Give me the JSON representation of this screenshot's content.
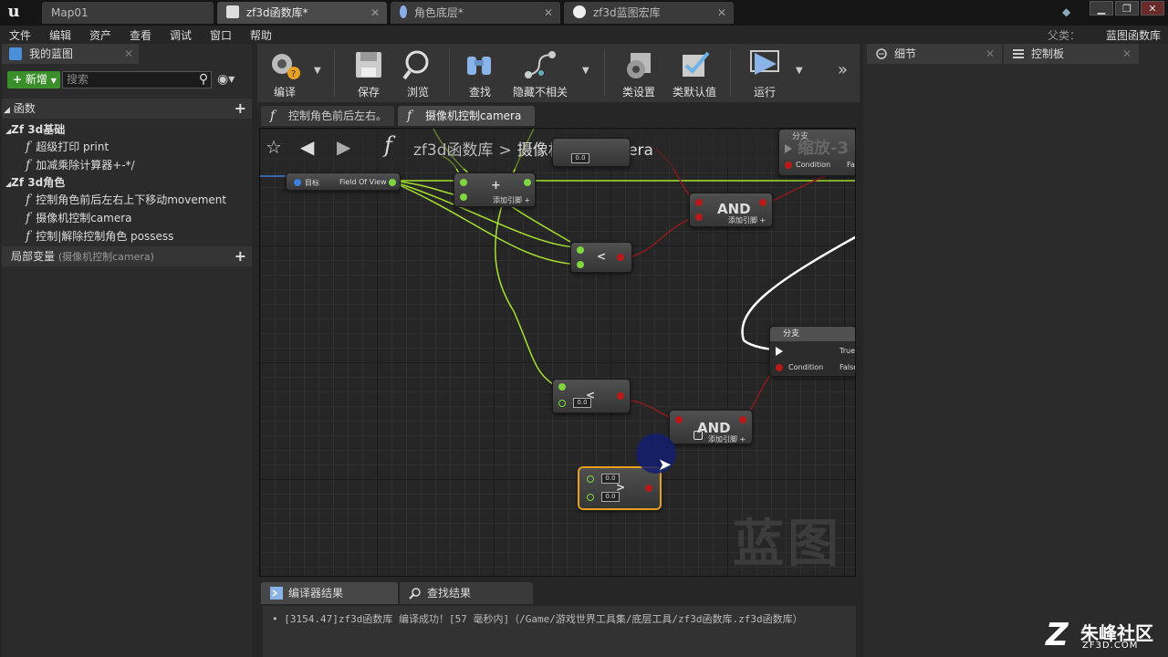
{
  "titlebar": {
    "tabs": [
      {
        "label": "Map01"
      },
      {
        "label": "zf3d函数库*"
      },
      {
        "label": "角色底层*"
      },
      {
        "label": "zf3d蓝图宏库"
      }
    ],
    "window_buttons": {
      "minimize": "▁",
      "maximize": "❐",
      "close": "✕"
    }
  },
  "menubar": {
    "items": [
      "文件",
      "编辑",
      "资产",
      "查看",
      "调试",
      "窗口",
      "帮助"
    ],
    "parent_label": "父类：",
    "parent_value": "蓝图函数库"
  },
  "left_panel": {
    "tab_label": "我的蓝图",
    "new_button": "新增",
    "search_placeholder": "搜索",
    "functions_header": "函数",
    "categories": [
      {
        "name": "Zf 3d基础",
        "items": [
          "超级打印 print",
          "加减乘除计算器+-*/"
        ]
      },
      {
        "name": "Zf 3d角色",
        "items": [
          "控制角色前后左右上下移动movement",
          "摄像机控制camera",
          "控制|解除控制角色 possess"
        ]
      }
    ],
    "locals_header": "局部变量",
    "locals_sub": "(摄像机控制camera)"
  },
  "toolbar": {
    "buttons": [
      {
        "label": "编译",
        "icon": "compile-icon"
      },
      {
        "label": "保存",
        "icon": "save-icon"
      },
      {
        "label": "浏览",
        "icon": "browse-icon"
      },
      {
        "label": "查找",
        "icon": "find-icon"
      },
      {
        "label": "隐藏不相关",
        "icon": "hide-unrelated-icon"
      },
      {
        "label": "类设置",
        "icon": "class-settings-icon"
      },
      {
        "label": "类默认值",
        "icon": "class-defaults-icon"
      },
      {
        "label": "运行",
        "icon": "play-icon"
      }
    ]
  },
  "doc_tabs": [
    {
      "label": "控制角色前后左右。"
    },
    {
      "label": "摄像机控制camera"
    }
  ],
  "graph": {
    "breadcrumb_root": "zf3d函数库",
    "breadcrumb_sep": ">",
    "breadcrumb_leaf": "摄像机控制camera",
    "watermark": "蓝图",
    "nodes": {
      "fov_target": "目标",
      "fov_value": "Field Of View",
      "add_title": "+",
      "add_pin_label": "添加引脚 +",
      "and1_title": "AND",
      "less_title": "<",
      "less2_title": "<",
      "and2_title": "AND",
      "greater_title": ">",
      "branch_title": "分支",
      "branch_condition": "Condition",
      "branch_true": "True",
      "branch_false": "False",
      "branch_top_title": "分支",
      "branch_top_condition": "Condition",
      "branch_top_false": "Fals",
      "scale_label": "缩放-3",
      "num": "0.0"
    }
  },
  "bottom_panel": {
    "tabs": [
      "编译器结果",
      "查找结果"
    ],
    "log": "[3154.47]zf3d函数库 编译成功！[57 毫秒内]（/Game/游戏世界工具集/底层工具/zf3d函数库.zf3d函数库）"
  },
  "right_panel": {
    "tabs": [
      "细节",
      "控制板"
    ]
  },
  "brand": {
    "name": "朱峰社区",
    "url": "ZF3D.COM"
  },
  "colors": {
    "exec_wire": "#ffffff",
    "float_wire": "#a6e22e",
    "bool_wire": "#8b1a1a",
    "new_button": "#3b8f2a"
  }
}
